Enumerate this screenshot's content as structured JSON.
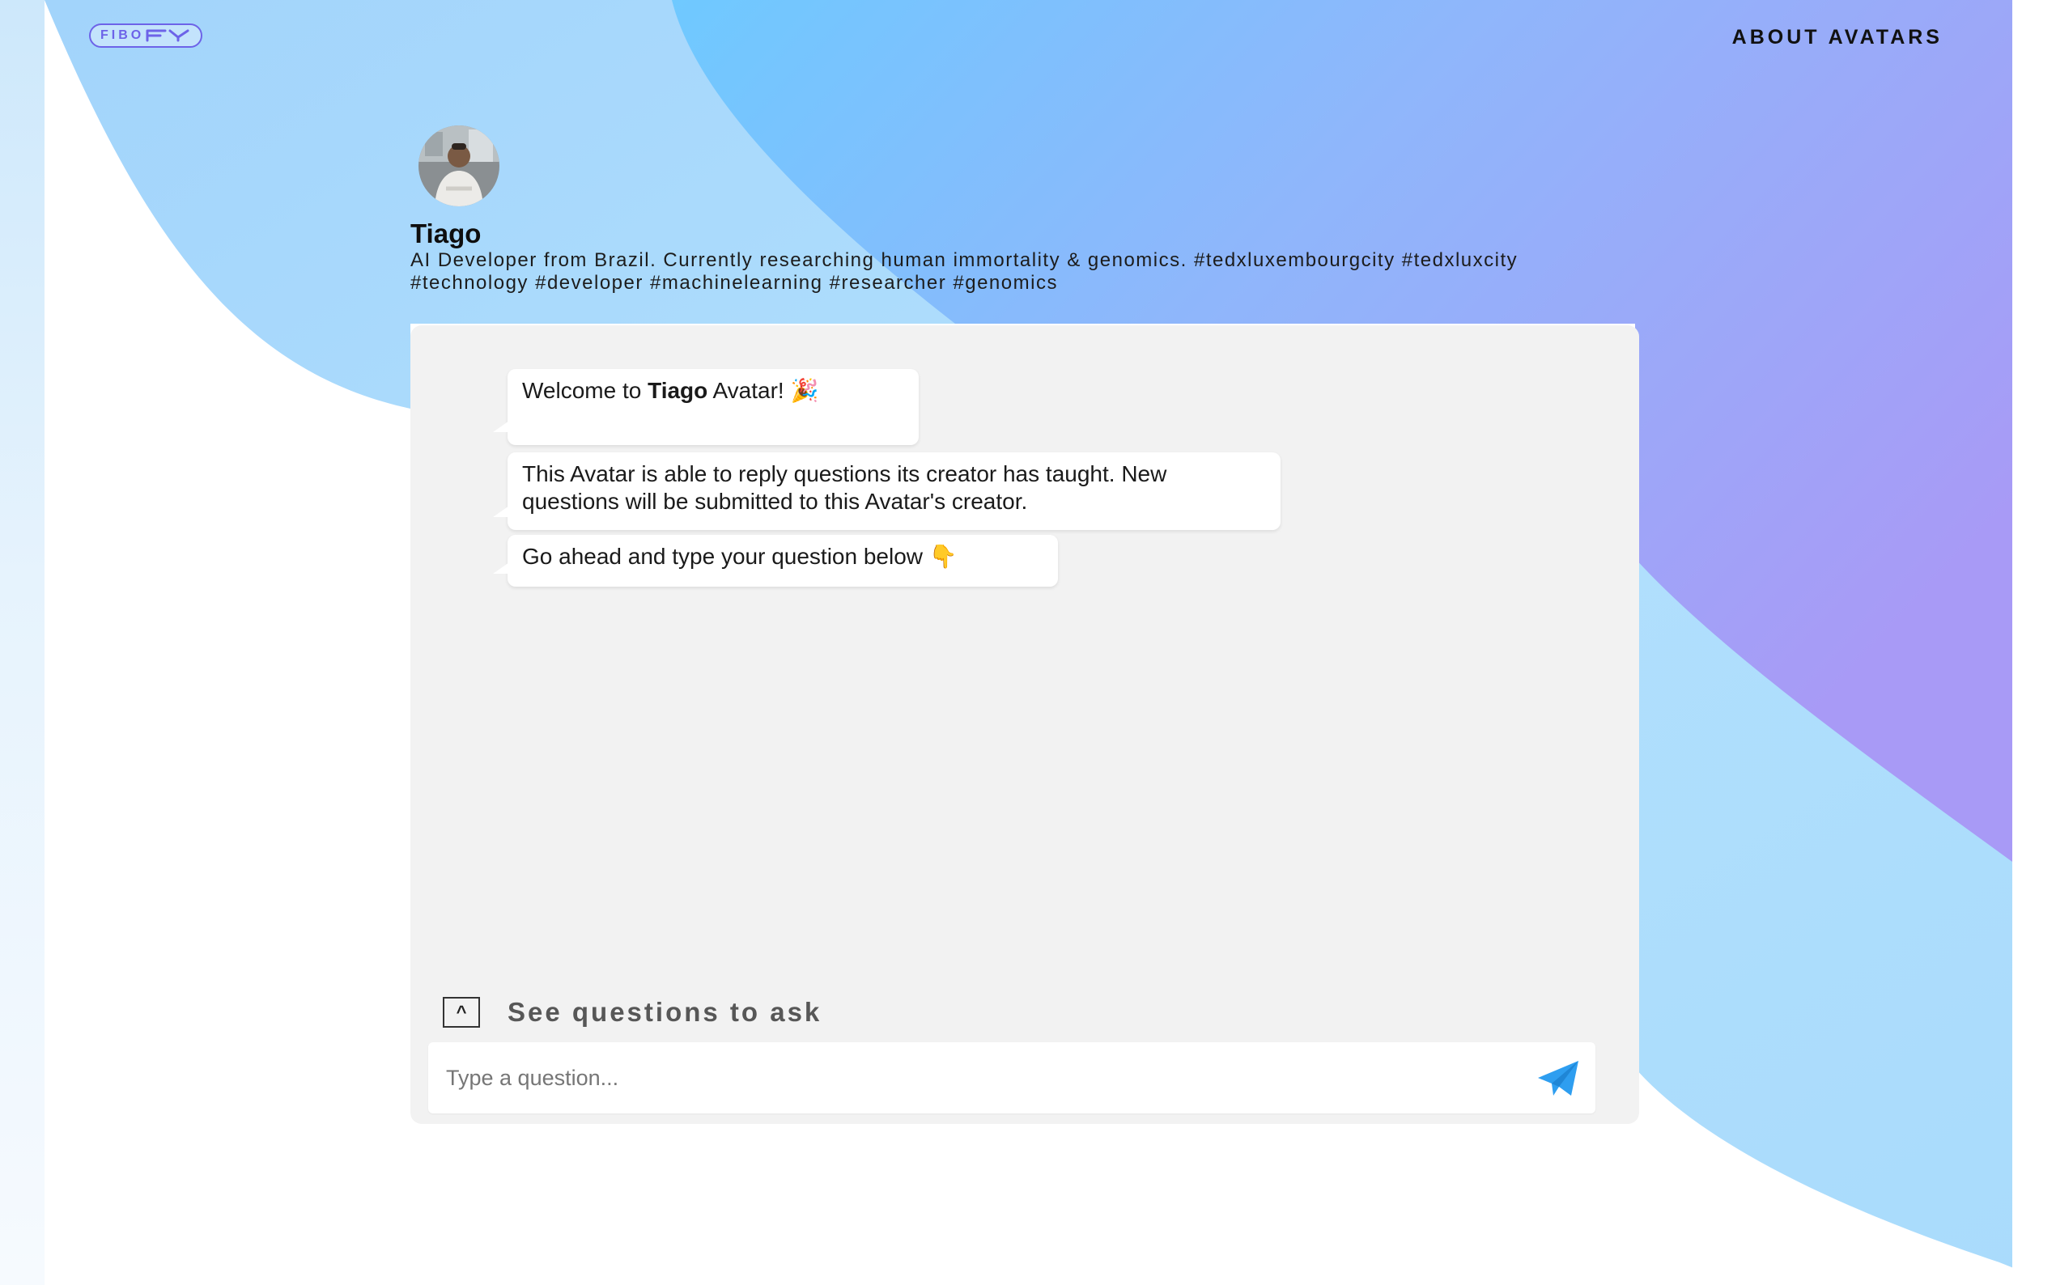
{
  "header": {
    "logo_text": "FIBO",
    "about_label": "ABOUT AVATARS"
  },
  "profile": {
    "name": "Tiago",
    "bio": "AI Developer from Brazil. Currently researching human immortality & genomics. #tedxluxembourgcity #tedxluxcity\n#technology #developer #machinelearning #researcher #genomics"
  },
  "chat": {
    "messages": [
      {
        "prefix": "Welcome to ",
        "bold": "Tiago",
        "suffix": " Avatar! 🎉"
      },
      {
        "text": "This Avatar is able to reply questions its creator has taught. New questions will be submitted to this Avatar's creator."
      },
      {
        "text": "Go ahead and type your question below 👇"
      }
    ],
    "toggle_icon": "^",
    "toggle_label": "See questions to ask",
    "input_placeholder": "Type a question...",
    "send_icon": "paper-plane-icon"
  },
  "colors": {
    "brand": "#6d63e8",
    "send": "#2e9ef0",
    "panel": "#f2f2f2"
  }
}
